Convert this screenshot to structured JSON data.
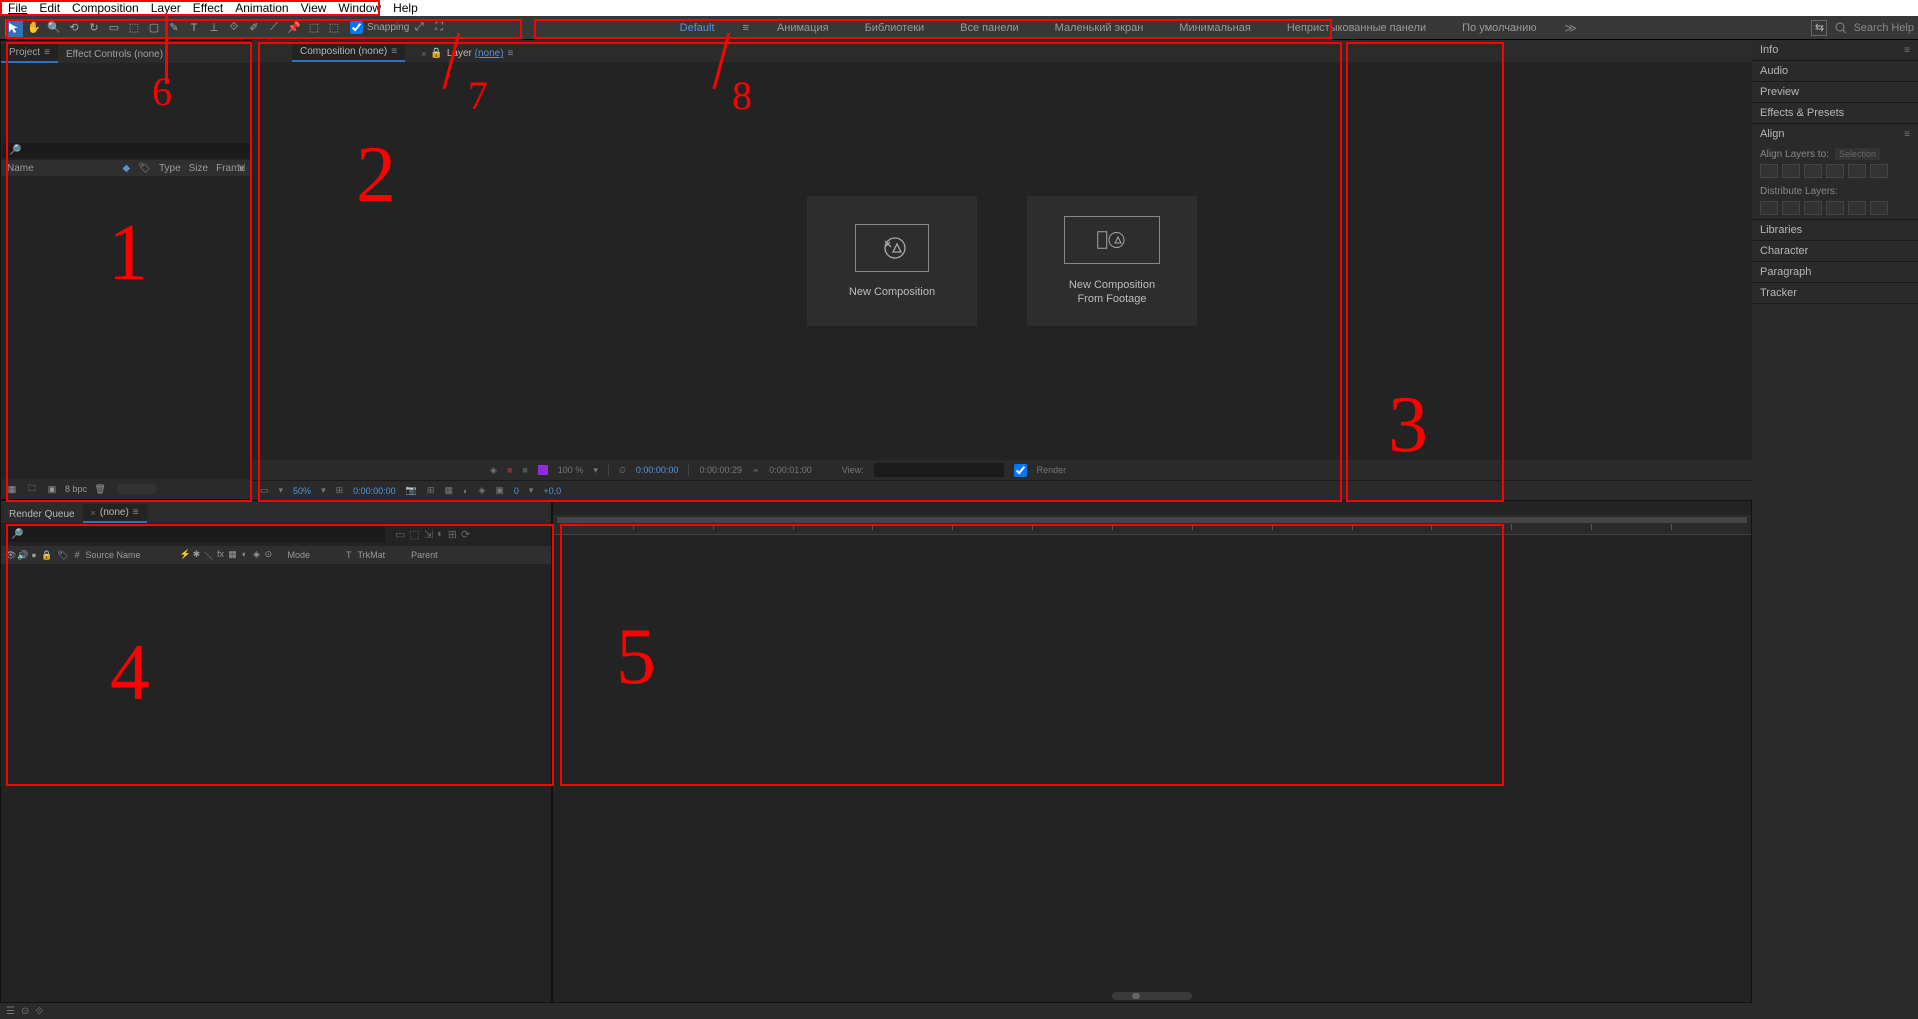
{
  "menu": [
    "File",
    "Edit",
    "Composition",
    "Layer",
    "Effect",
    "Animation",
    "View",
    "Window",
    "Help"
  ],
  "toolbar": {
    "snapping": "Snapping",
    "search_placeholder": "Search Help"
  },
  "workspaces": {
    "items": [
      "Default",
      "Анимация",
      "Библиотеки",
      "Все панели",
      "Маленький экран",
      "Минимальная",
      "Непристыкованные панели",
      "По умолчанию"
    ],
    "dd": "≫"
  },
  "project": {
    "tab": "Project",
    "ec_tab": "Effect Controls (none)",
    "cols": {
      "name": "Name",
      "type": "Type",
      "size": "Size",
      "frame": "Frame"
    },
    "bpc": "8 bpc"
  },
  "comp": {
    "tab": "Composition (none)",
    "layer_tab": "Layer (none)",
    "new_comp": "New Composition",
    "new_comp_footage_l1": "New Composition",
    "new_comp_footage_l2": "From Footage",
    "footer": {
      "zoom": "100 %",
      "tc1": "0:00:00:00",
      "tc2": "0:00:00:29",
      "tc3": "0:00:01:00",
      "view": "View:",
      "render": "Render"
    },
    "footer2": {
      "zoom": "50%",
      "tc": "0:00:00:00",
      "values": "0",
      "plus": "+0,0"
    }
  },
  "right_panels": {
    "info": "Info",
    "audio": "Audio",
    "preview": "Preview",
    "ep": "Effects & Presets",
    "align": "Align",
    "align_to": "Align Layers to:",
    "align_sel": "Selection",
    "dist": "Distribute Layers:",
    "libs": "Libraries",
    "char": "Character",
    "para": "Paragraph",
    "tracker": "Tracker"
  },
  "timeline": {
    "rq_tab": "Render Queue",
    "none_tab": "(none)",
    "cols": {
      "num": "#",
      "src": "Source Name",
      "mode": "Mode",
      "t": "T",
      "trk": "TrkMat",
      "parent": "Parent"
    }
  },
  "annotations": {
    "1": "1",
    "2": "2",
    "3": "3",
    "4": "4",
    "5": "5",
    "6": "6",
    "7": "7",
    "8": "8"
  }
}
